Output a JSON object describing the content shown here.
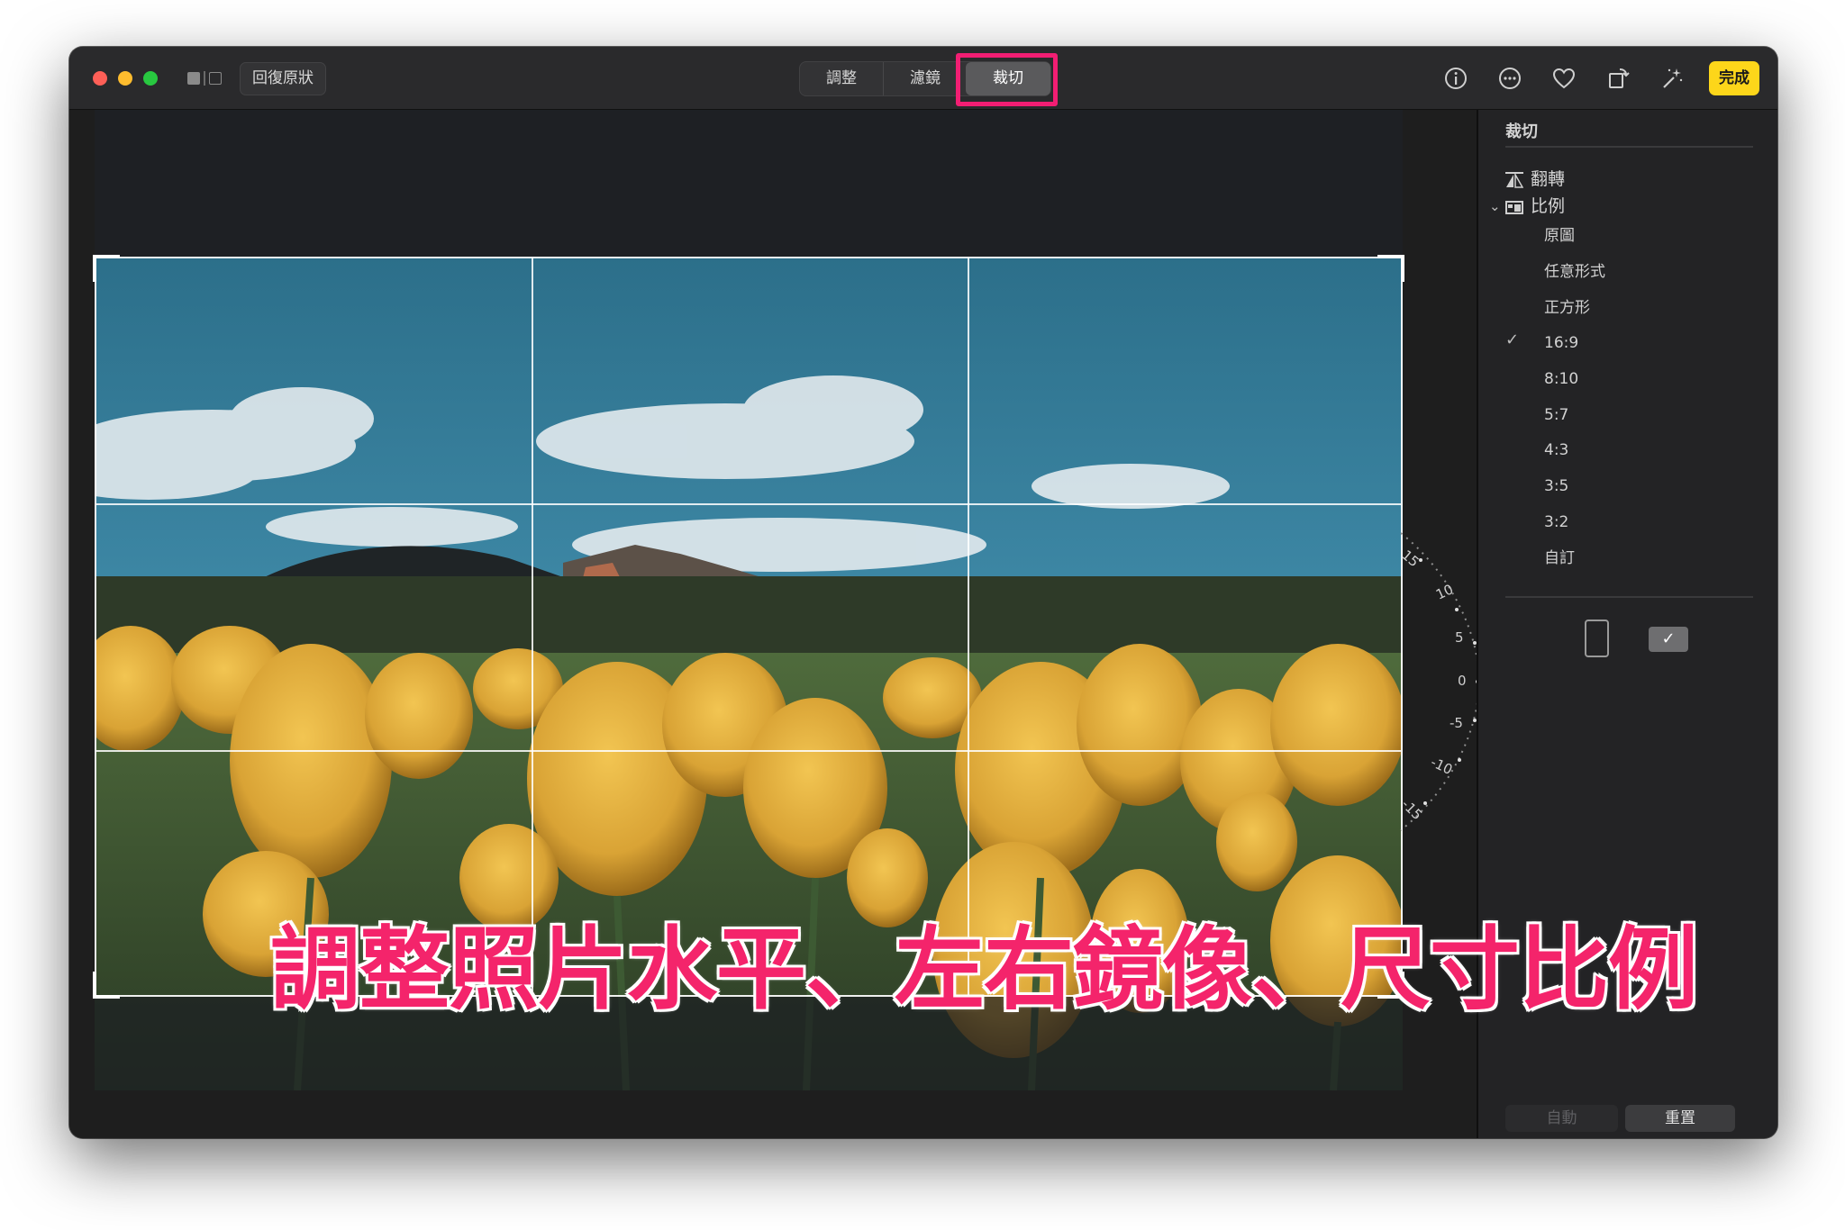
{
  "toolbar": {
    "revert_label": "回復原狀",
    "tabs": [
      {
        "label": "調整"
      },
      {
        "label": "濾鏡"
      },
      {
        "label": "裁切"
      }
    ],
    "done_label": "完成",
    "icons": [
      "info-icon",
      "more-icon",
      "heart-icon",
      "rotate-icon",
      "magic-wand-icon"
    ]
  },
  "canvas": {
    "dial_labels": [
      "15",
      "10",
      "5",
      "0",
      "-5",
      "-10",
      "-15"
    ],
    "dial_value": "0"
  },
  "caption": "調整照片水平、左右鏡像、尺寸比例",
  "sidebar": {
    "title": "裁切",
    "flip_label": "翻轉",
    "aspect_label": "比例",
    "ratios": [
      {
        "label": "原圖",
        "checked": false
      },
      {
        "label": "任意形式",
        "checked": false
      },
      {
        "label": "正方形",
        "checked": false
      },
      {
        "label": "16:9",
        "checked": true
      },
      {
        "label": "8:10",
        "checked": false
      },
      {
        "label": "5:7",
        "checked": false
      },
      {
        "label": "4:3",
        "checked": false
      },
      {
        "label": "3:5",
        "checked": false
      },
      {
        "label": "3:2",
        "checked": false
      },
      {
        "label": "自訂",
        "checked": false
      }
    ],
    "check_mark": "✓",
    "auto_label": "自動",
    "reset_label": "重置"
  },
  "colors": {
    "accent_yellow": "#fdd61a",
    "highlight_pink": "#f21e73",
    "dial_marker_blue": "#3b8bff"
  }
}
